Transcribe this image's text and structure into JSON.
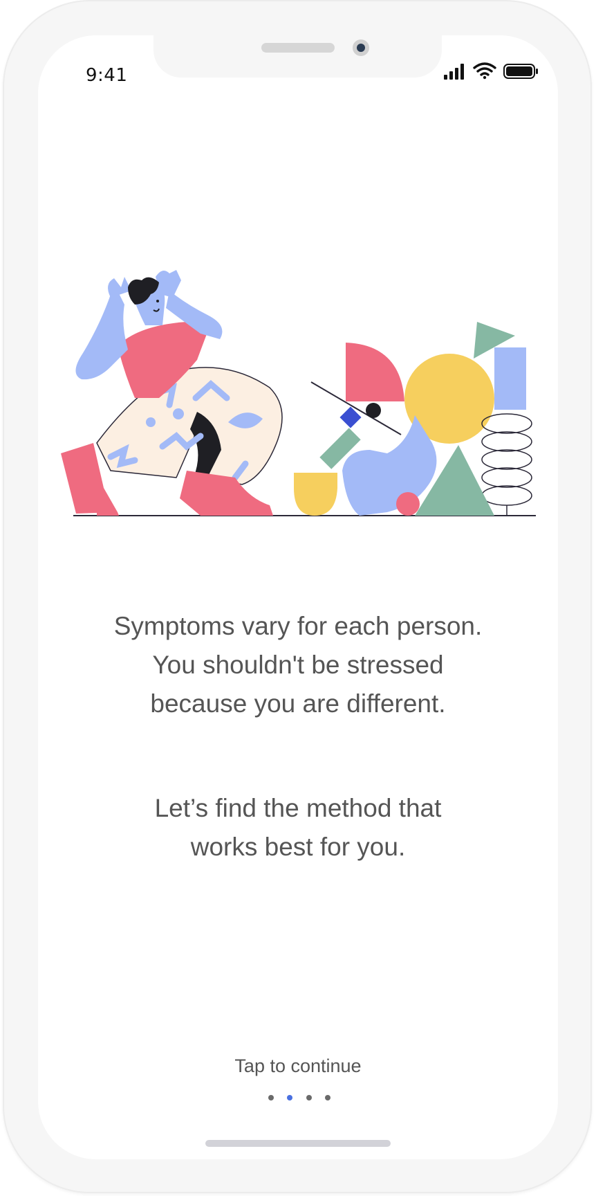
{
  "status_bar": {
    "time": "9:41",
    "signal_icon": "cellular-signal-icon",
    "wifi_icon": "wifi-icon",
    "battery_icon": "battery-icon"
  },
  "onboarding": {
    "illustration": "stressed-person-with-shapes-illustration",
    "message_lines": [
      "Symptoms vary for each person.",
      "You shouldn't be stressed",
      "because you are different."
    ],
    "secondary_lines": [
      "Let’s find the method that",
      "works best for you."
    ],
    "cta_label": "Tap to continue",
    "pagination": {
      "total": 4,
      "current": 2
    }
  },
  "colors": {
    "text": "#555555",
    "accent": "#4a70e0",
    "pink": "#ef6b80",
    "blue": "#a3baf7",
    "yellow": "#f6cf5e",
    "green": "#86b8a3",
    "cream": "#fcefe2"
  }
}
